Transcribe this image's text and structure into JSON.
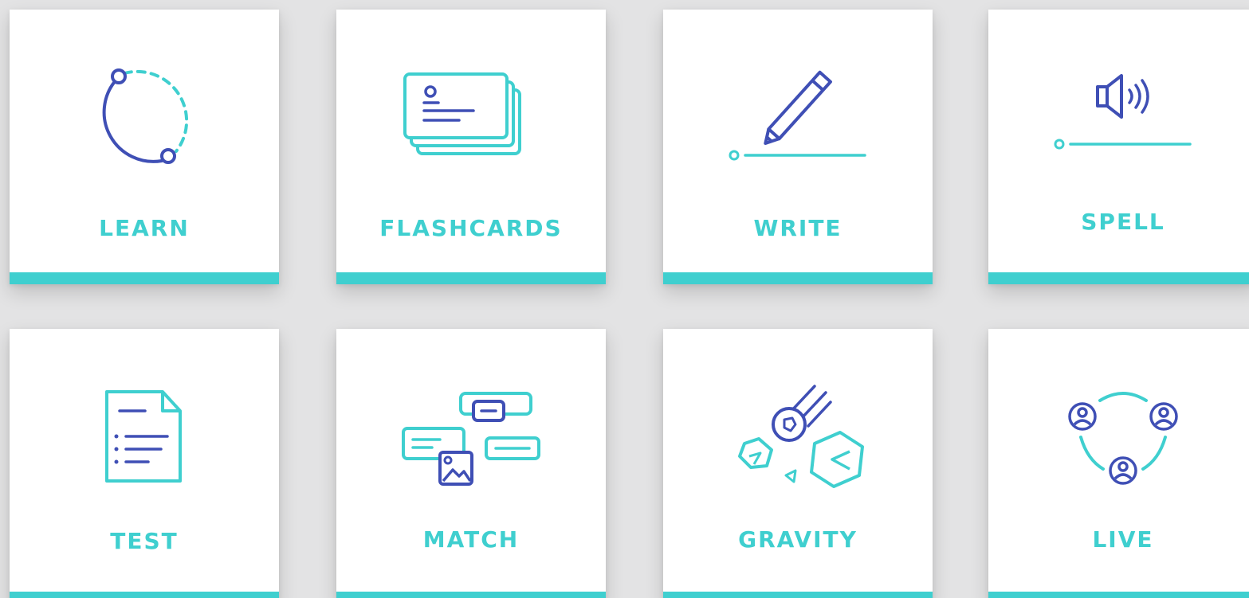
{
  "colors": {
    "accent": "#3fcfcf",
    "primary": "#3f4fb5",
    "background": "#e3e3e4",
    "tile": "#ffffff"
  },
  "modes": [
    {
      "key": "learn",
      "label": "LEARN",
      "icon": "learn-icon"
    },
    {
      "key": "flashcards",
      "label": "FLASHCARDS",
      "icon": "flashcards-icon"
    },
    {
      "key": "write",
      "label": "WRITE",
      "icon": "write-icon"
    },
    {
      "key": "spell",
      "label": "SPELL",
      "icon": "spell-icon"
    },
    {
      "key": "test",
      "label": "TEST",
      "icon": "test-icon"
    },
    {
      "key": "match",
      "label": "MATCH",
      "icon": "match-icon"
    },
    {
      "key": "gravity",
      "label": "GRAVITY",
      "icon": "gravity-icon"
    },
    {
      "key": "live",
      "label": "LIVE",
      "icon": "live-icon"
    }
  ]
}
